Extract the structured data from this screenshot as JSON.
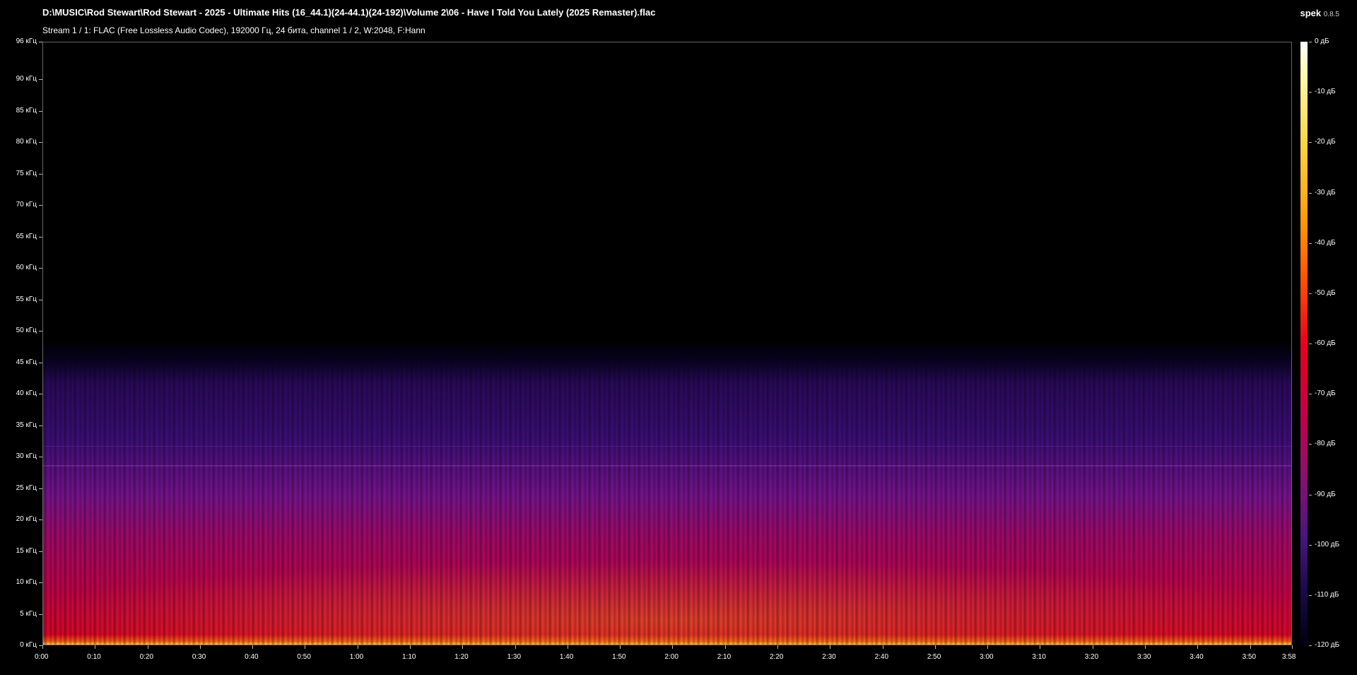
{
  "header": {
    "file_path": "D:\\MUSIC\\Rod Stewart\\Rod Stewart - 2025 - Ultimate Hits (16_44.1)(24-44.1)(24-192)\\Volume 2\\06 - Have I Told You Lately (2025 Remaster).flac",
    "stream_info": "Stream 1 / 1: FLAC (Free Lossless Audio Codec), 192000 Гц, 24 бита, channel 1 / 2, W:2048, F:Hann",
    "app_name": "spek",
    "app_version": "0.8.5"
  },
  "y_axis_labels": [
    "96 кГц",
    "90 кГц",
    "85 кГц",
    "80 кГц",
    "75 кГц",
    "70 кГц",
    "65 кГц",
    "60 кГц",
    "55 кГц",
    "50 кГц",
    "45 кГц",
    "40 кГц",
    "35 кГц",
    "30 кГц",
    "25 кГц",
    "20 кГц",
    "15 кГц",
    "10 кГц",
    "5 кГц",
    "0 кГц"
  ],
  "y_axis_values_khz": [
    96,
    90,
    85,
    80,
    75,
    70,
    65,
    60,
    55,
    50,
    45,
    40,
    35,
    30,
    25,
    20,
    15,
    10,
    5,
    0
  ],
  "x_axis_labels": [
    "0:00",
    "0:10",
    "0:20",
    "0:30",
    "0:40",
    "0:50",
    "1:00",
    "1:10",
    "1:20",
    "1:30",
    "1:40",
    "1:50",
    "2:00",
    "2:10",
    "2:20",
    "2:30",
    "2:40",
    "2:50",
    "3:00",
    "3:10",
    "3:20",
    "3:30",
    "3:40",
    "3:50",
    "3:58"
  ],
  "x_axis_values_sec": [
    0,
    10,
    20,
    30,
    40,
    50,
    60,
    70,
    80,
    90,
    100,
    110,
    120,
    130,
    140,
    150,
    160,
    170,
    180,
    190,
    200,
    210,
    220,
    230,
    238
  ],
  "colorbar_labels": [
    "0 дБ",
    "-10 дБ",
    "-20 дБ",
    "-30 дБ",
    "-40 дБ",
    "-50 дБ",
    "-60 дБ",
    "-70 дБ",
    "-80 дБ",
    "-90 дБ",
    "-100 дБ",
    "-110 дБ",
    "-120 дБ"
  ],
  "colorbar_values_db": [
    0,
    -10,
    -20,
    -30,
    -40,
    -50,
    -60,
    -70,
    -80,
    -90,
    -100,
    -110,
    -120
  ],
  "spectrogram": {
    "max_freq_khz": 96,
    "duration_sec": 238,
    "content_cutoff_khz": 41
  }
}
